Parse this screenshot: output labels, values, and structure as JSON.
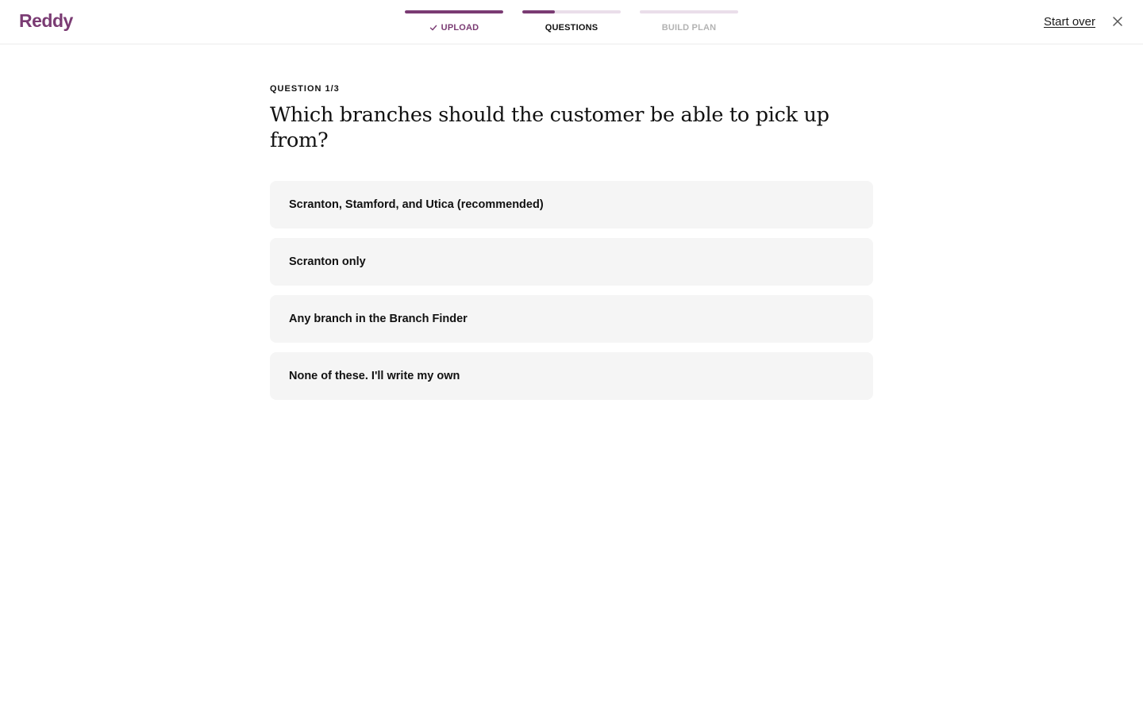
{
  "brand": {
    "logo": "Reddy",
    "accent_color": "#7a3b73"
  },
  "stepper": {
    "steps": [
      {
        "label": "UPLOAD",
        "state": "done",
        "progress": 1.0,
        "icon": "check-icon"
      },
      {
        "label": "QUESTIONS",
        "state": "active",
        "progress": 0.33
      },
      {
        "label": "BUILD PLAN",
        "state": "todo",
        "progress": 0.0
      }
    ]
  },
  "header": {
    "start_over_label": "Start over",
    "close_icon": "close-icon"
  },
  "question": {
    "counter": "QUESTION 1/3",
    "title": "Which branches should the customer be able to pick up from?",
    "options": [
      "Scranton, Stamford, and Utica (recommended)",
      "Scranton only",
      "Any branch in the Branch Finder",
      "None of these. I'll write my own"
    ]
  }
}
